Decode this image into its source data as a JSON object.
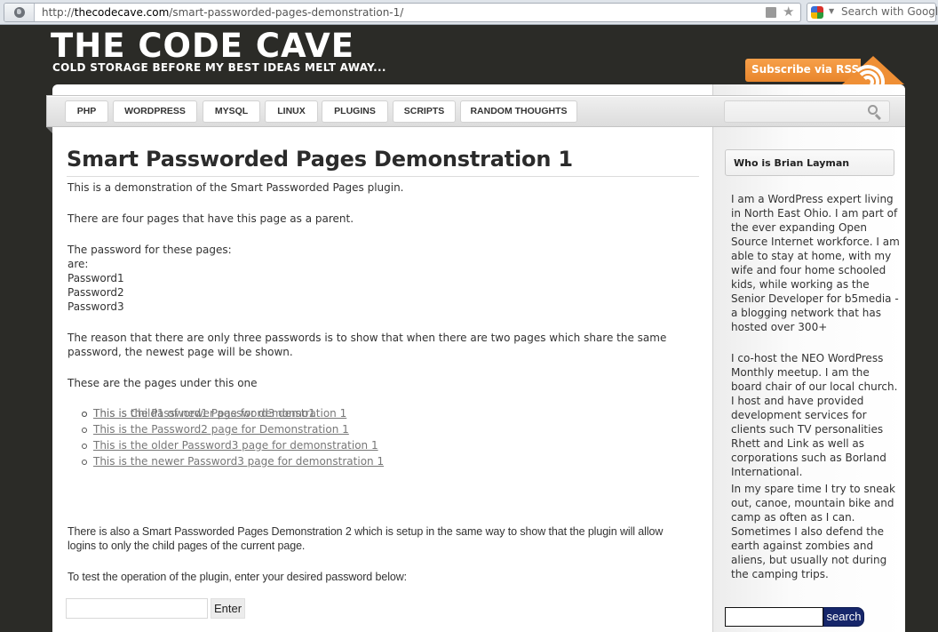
{
  "browser": {
    "url_scheme": "http://",
    "url_domain": "thecodecave.com",
    "url_path": "/smart-passworded-pages-demonstration-1/",
    "search_placeholder": "Search with Google"
  },
  "header": {
    "site_title": "THE CODE CAVE",
    "tagline": "COLD STORAGE BEFORE MY BEST IDEAS MELT AWAY...",
    "rss_label": "Subscribe via RSS",
    "accent_color": "#ef8f35"
  },
  "nav": {
    "items": [
      {
        "label": "PHP"
      },
      {
        "label": "WORDPRESS"
      },
      {
        "label": "MYSQL"
      },
      {
        "label": "LINUX"
      },
      {
        "label": "PLUGINS"
      },
      {
        "label": "SCRIPTS"
      },
      {
        "label": "RANDOM THOUGHTS"
      }
    ],
    "search_value": ""
  },
  "post": {
    "title": "Smart Passworded Pages Demonstration 1",
    "intro": "This is a demonstration of the Smart Passworded Pages plugin.",
    "parent_note": "There are four pages that have this page as a parent.",
    "password_heading": "The password for these pages:",
    "are": "are:",
    "passwords": [
      "Password1",
      "Password2",
      "Password3"
    ],
    "reason_line1": "The reason that there are only three passwords is to show that when there are two pages which share the same",
    "reason_line2": "password, the newest page will be shown.",
    "pages_under": "These are the pages under this one",
    "child_pages": [
      {
        "label": "This is the Password1 Page for demonstration 1"
      },
      {
        "label": "This is the Password2 page for Demonstration 1"
      },
      {
        "label": "This is the older Password3 page for demonstration 1"
      },
      {
        "label": "This is the newer Password3 page for demonstration 1"
      }
    ],
    "grandchild_pages": [
      {
        "label": "This is Child1 of newer password3 demo1"
      }
    ],
    "demo2_line1": "There is also a Smart Passworded Pages Demonstration 2 which is setup in the same way to show that the plugin will allow",
    "demo2_line2": "logins to only the child pages of the current page.",
    "test_prompt": "To test the operation of the plugin, enter your desired password below:",
    "password_value": "",
    "enter_label": "Enter"
  },
  "sidebar": {
    "widget_title": "Who is Brian Layman",
    "paragraphs": [
      "I am a WordPress expert living in North East Ohio. I am part of the ever expanding Open Source Internet workforce. I am able to stay at home, with my wife and four home schooled kids, while working as the Senior Developer for b5media - a blogging network that has hosted over 300+",
      "I co-host the NEO WordPress Monthly meetup. I am the board chair of our local church. I host and have provided development services for clients such TV personalities Rhett and Link as well as corporations such as Borland International.",
      "In my spare time I try to sneak out, canoe, mountain bike and camp as often as I can. Sometimes I also defend the earth against zombies and aliens, but usually not during the camping trips."
    ],
    "search_value": "",
    "search_label": "search"
  }
}
